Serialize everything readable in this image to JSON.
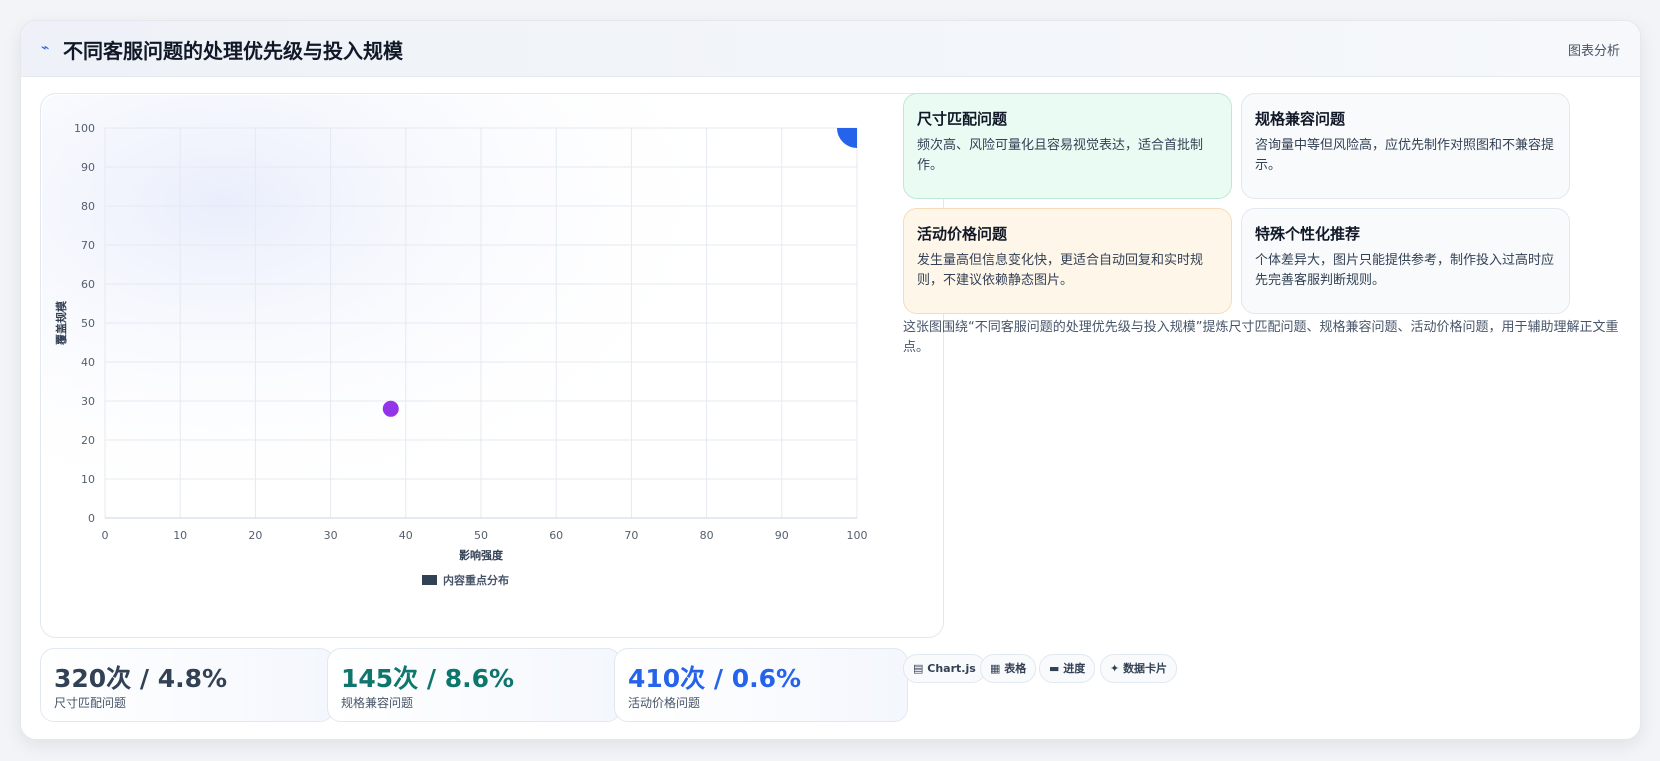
{
  "header": {
    "icon": "pulse-icon",
    "title": "不同客服问题的处理优先级与投入规模",
    "link_label": "图表分析"
  },
  "chart_data": {
    "type": "scatter",
    "xlabel": "影响强度",
    "ylabel": "覆盖规模",
    "xlim": [
      0,
      100
    ],
    "ylim": [
      0,
      100
    ],
    "x_ticks": [
      "0",
      "10",
      "20",
      "30",
      "40",
      "50",
      "60",
      "70",
      "80",
      "90",
      "100"
    ],
    "y_ticks": [
      "0",
      "10",
      "20",
      "30",
      "40",
      "50",
      "60",
      "70",
      "80",
      "90",
      "100"
    ],
    "grid": true,
    "legend_position": "bottom-center",
    "series": [
      {
        "name": "内容重点分布",
        "legend_color": "#334155",
        "points": [
          {
            "x": 38,
            "y": 28,
            "size": "small",
            "color": "#9333ea"
          },
          {
            "x": 100,
            "y": 100,
            "size": "large",
            "color": "#2563eb"
          }
        ]
      }
    ]
  },
  "stats": [
    {
      "value": "320次 / 4.8%",
      "label": "尺寸匹配问题",
      "color": "#334155"
    },
    {
      "value": "145次 / 8.6%",
      "label": "规格兼容问题",
      "color": "#0f766e"
    },
    {
      "value": "410次 / 0.6%",
      "label": "活动价格问题",
      "color": "#2563eb"
    }
  ],
  "insights": [
    {
      "title": "尺寸匹配问题",
      "body": "频次高、风险可量化且容易视觉表达，适合首批制作。",
      "bg": "#eafbf3",
      "border": "#bde9d2"
    },
    {
      "title": "规格兼容问题",
      "body": "咨询量中等但风险高，应优先制作对照图和不兼容提示。",
      "bg": "#f8fafc",
      "border": "#e2e8f0"
    },
    {
      "title": "活动价格问题",
      "body": "发生量高但信息变化快，更适合自动回复和实时规则，不建议依赖静态图片。",
      "bg": "#fff6ea",
      "border": "#f5dbb8"
    },
    {
      "title": "特殊个性化推荐",
      "body": "个体差异大，图片只能提供参考，制作投入过高时应先完善客服判断规则。",
      "bg": "#f8fafc",
      "border": "#e2e8f0"
    }
  ],
  "caption": "这张图围绕“不同客服问题的处理优先级与投入规模”提炼尺寸匹配问题、规格兼容问题、活动价格问题，用于辅助理解正文重点。",
  "chips": [
    {
      "icon": "chart-icon",
      "glyph": "▤",
      "label": "Chart.js"
    },
    {
      "icon": "table-icon",
      "glyph": "▦",
      "label": "表格"
    },
    {
      "icon": "progress-icon",
      "glyph": "▬",
      "label": "进度"
    },
    {
      "icon": "sparkle-icon",
      "glyph": "✦",
      "label": "数据卡片"
    }
  ]
}
